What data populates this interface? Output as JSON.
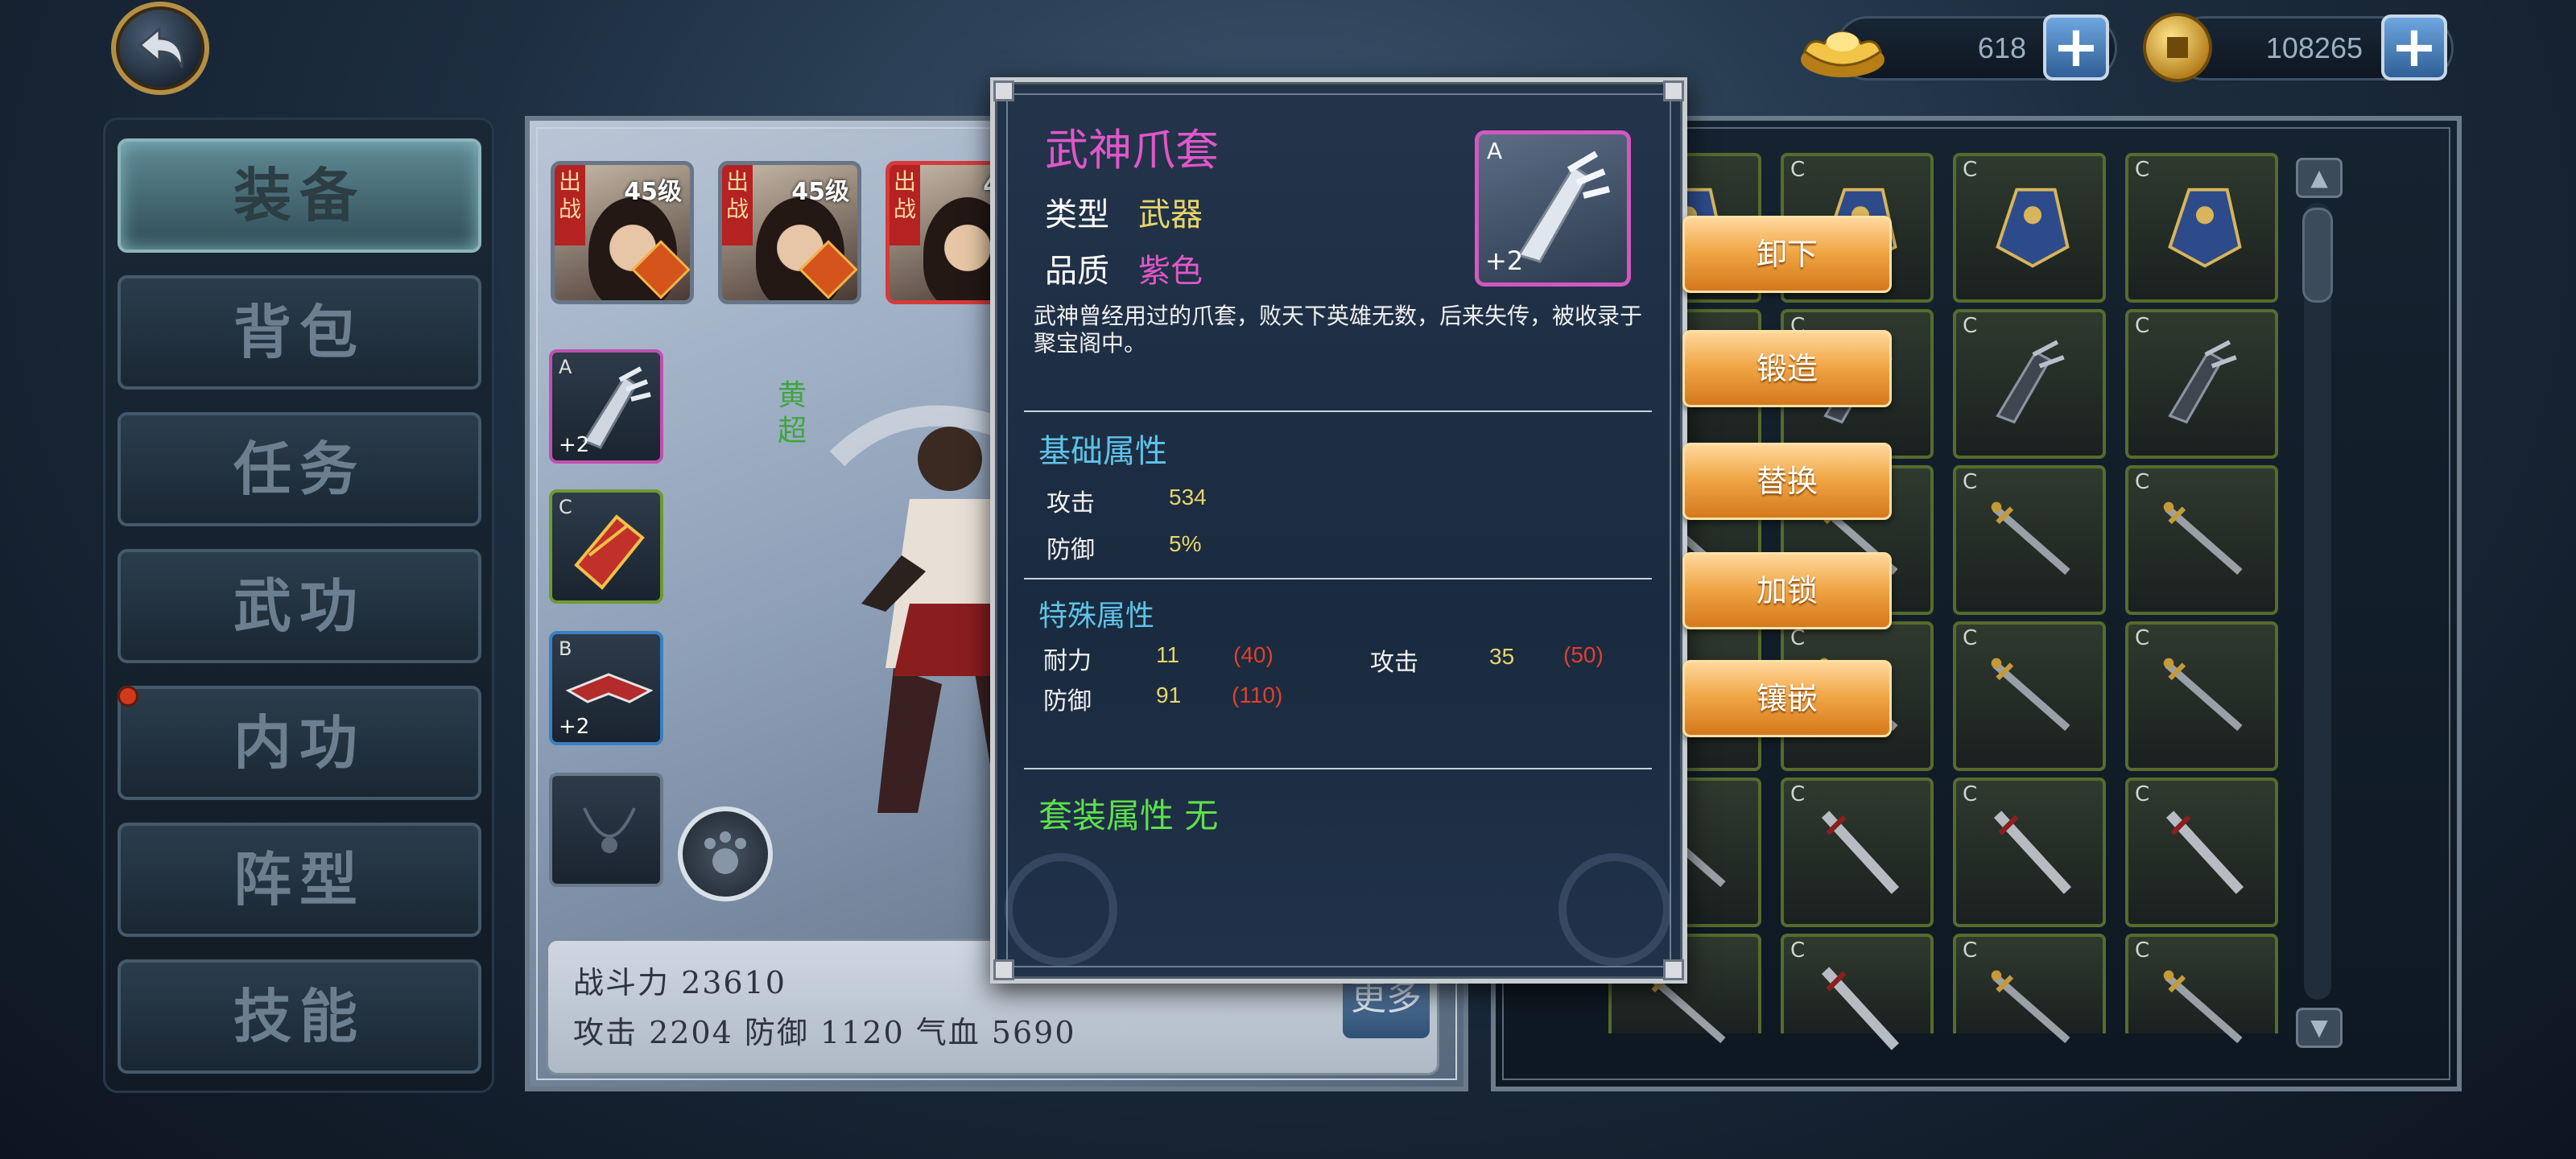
{
  "currency": {
    "ingot_value": "618",
    "coin_value": "108265",
    "add_symbol": "+"
  },
  "nav": {
    "items": [
      "装备",
      "背包",
      "任务",
      "武功",
      "内功",
      "阵型",
      "技能"
    ],
    "active_index": 0
  },
  "heroes": [
    {
      "tag": "出战",
      "level": "45级"
    },
    {
      "tag": "出战",
      "level": "45级"
    },
    {
      "tag": "出战",
      "level": "44"
    }
  ],
  "equip_slots": [
    {
      "grade": "A",
      "plus": "+2"
    },
    {
      "grade": "C",
      "plus": ""
    },
    {
      "grade": "B",
      "plus": "+2"
    },
    {
      "grade": "",
      "plus": ""
    }
  ],
  "hero_name": "黄超",
  "stats": {
    "line1": "战斗力 23610",
    "line2": "攻击  2204  防御  1120  气血  5690",
    "more_label": "更多"
  },
  "actions": [
    "卸下",
    "锻造",
    "替换",
    "加锁",
    "镶嵌"
  ],
  "tooltip": {
    "title": "武神爪套",
    "type_label": "类型",
    "type_value": "武器",
    "quality_label": "品质",
    "quality_value": "紫色",
    "icon_grade": "A",
    "icon_plus": "+2",
    "description": "武神曾经用过的爪套，败天下英雄无数，后来失传，被收录于聚宝阁中。",
    "base_title": "基础属性",
    "base_attrs": [
      {
        "name": "攻击",
        "value": "534"
      },
      {
        "name": "防御",
        "value": "5%"
      }
    ],
    "special_title": "特殊属性",
    "special_attrs": [
      {
        "name": "耐力",
        "value": "11",
        "max": "(40)"
      },
      {
        "name": "攻击",
        "value": "35",
        "max": "(50)"
      },
      {
        "name": "防御",
        "value": "91",
        "max": "(110)"
      }
    ],
    "set_title": "套装属性 无"
  },
  "bag": {
    "cells": [
      {
        "grade": "C",
        "kind": "bracer"
      },
      {
        "grade": "C",
        "kind": "bracer"
      },
      {
        "grade": "C",
        "kind": "bracer"
      },
      {
        "grade": "C",
        "kind": "bracer"
      },
      {
        "grade": "",
        "kind": "claw"
      },
      {
        "grade": "C",
        "kind": "claw"
      },
      {
        "grade": "C",
        "kind": "claw"
      },
      {
        "grade": "C",
        "kind": "claw"
      },
      {
        "grade": "",
        "kind": "sword"
      },
      {
        "grade": "C",
        "kind": "sword"
      },
      {
        "grade": "C",
        "kind": "sword"
      },
      {
        "grade": "C",
        "kind": "sword"
      },
      {
        "grade": "",
        "kind": "sword"
      },
      {
        "grade": "C",
        "kind": "sword"
      },
      {
        "grade": "C",
        "kind": "sword"
      },
      {
        "grade": "C",
        "kind": "sword"
      },
      {
        "grade": "",
        "kind": "sword"
      },
      {
        "grade": "C",
        "kind": "blade"
      },
      {
        "grade": "C",
        "kind": "blade"
      },
      {
        "grade": "C",
        "kind": "blade"
      },
      {
        "grade": "",
        "kind": "sword"
      },
      {
        "grade": "C",
        "kind": "blade"
      },
      {
        "grade": "C",
        "kind": "sword"
      },
      {
        "grade": "C",
        "kind": "sword"
      }
    ],
    "scroll_up": "▲",
    "scroll_down": "▼"
  }
}
